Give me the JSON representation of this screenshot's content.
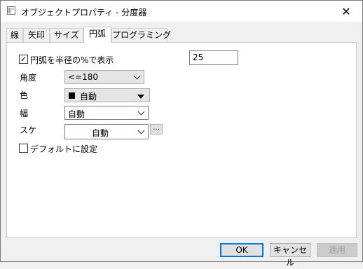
{
  "window": {
    "title": "オブジェクトプロパティ - 分度器",
    "close_glyph": "✕"
  },
  "tabs": [
    {
      "label": "線",
      "active": false
    },
    {
      "label": "矢印",
      "active": false
    },
    {
      "label": "サイズ",
      "active": false
    },
    {
      "label": "円弧",
      "active": true
    },
    {
      "label": "プログラミング",
      "active": false
    }
  ],
  "arc_tab": {
    "show_radius_checkbox": {
      "label": "円弧を半径の%で表示",
      "checked": true,
      "check_glyph": "✓"
    },
    "radius_percent": "25",
    "angle": {
      "label": "角度",
      "value": "<=180"
    },
    "color": {
      "label": "色",
      "value": "自動",
      "swatch_color": "#000000"
    },
    "width": {
      "label": "幅",
      "value": "自動"
    },
    "scale": {
      "label": "スケ",
      "value": "自動",
      "more_button": "..."
    },
    "set_default_checkbox": {
      "label": "デフォルトに設定",
      "checked": false
    }
  },
  "footer": {
    "ok": "OK",
    "cancel": "キャンセル",
    "apply": "適用"
  }
}
